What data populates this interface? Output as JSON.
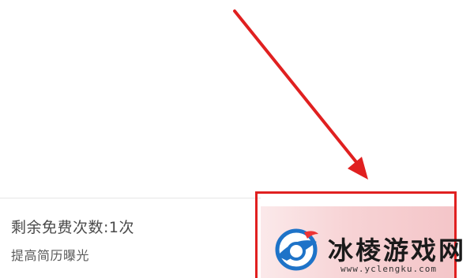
{
  "info": {
    "remaining_free": "剩余免费次数:1次",
    "subtitle": "提高简历曝光"
  },
  "watermark": {
    "name": "冰棱游戏网",
    "url": "www.yclengku.com"
  },
  "colors": {
    "annotation_red": "#e02020",
    "button_pink": "#f7d3d5",
    "text_gray": "#4a4a4a",
    "logo_blue": "#1e73c8"
  }
}
